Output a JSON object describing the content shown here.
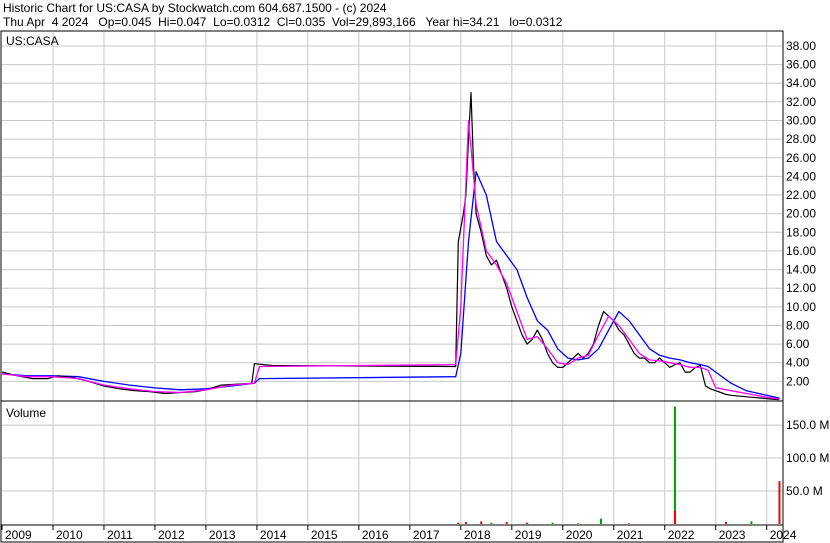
{
  "header": {
    "line1": "Historic Chart for US:CASA by Stockwatch.com 604.687.1500 - (c) 2024",
    "line2": "Thu Apr  4 2024   Op=0.045  Hi=0.047  Lo=0.0312  Cl=0.035  Vol=29,893,166   Year hi=34.21   lo=0.0312"
  },
  "price_panel_label": "US:CASA",
  "volume_panel_label": "Volume",
  "colors": {
    "grid": "#c8c8c8",
    "price_bars": "#000000",
    "ma_short": "#ff00ff",
    "ma_long": "#0000ff",
    "volume_up": "#00a000",
    "volume_down": "#ff0000",
    "frame": "#000000"
  },
  "chart_data": [
    {
      "type": "line",
      "panel": "price",
      "x_ticks": [
        "2009",
        "2010",
        "2011",
        "2012",
        "2013",
        "2014",
        "2015",
        "2016",
        "2017",
        "2018",
        "2019",
        "2020",
        "2021",
        "2022",
        "2023",
        "2024"
      ],
      "y_ticks": [
        "2.00",
        "4.00",
        "6.00",
        "8.00",
        "10.00",
        "12.00",
        "14.00",
        "16.00",
        "18.00",
        "20.00",
        "22.00",
        "24.00",
        "26.00",
        "28.00",
        "30.00",
        "32.00",
        "34.00",
        "36.00",
        "38.00"
      ],
      "ylim": [
        0,
        39.5
      ],
      "xlim": [
        2009.0,
        2024.3
      ],
      "series": [
        {
          "role": "price",
          "x": [
            2009.0,
            2009.3,
            2009.6,
            2009.9,
            2010.1,
            2010.4,
            2010.7,
            2011.0,
            2011.3,
            2011.6,
            2011.9,
            2012.2,
            2012.5,
            2012.8,
            2013.0,
            2013.3,
            2013.6,
            2013.9,
            2013.95,
            2014.3,
            2017.9,
            2017.95,
            2018.05,
            2018.1,
            2018.15,
            2018.2,
            2018.25,
            2018.3,
            2018.4,
            2018.5,
            2018.6,
            2018.7,
            2018.8,
            2018.9,
            2019.0,
            2019.1,
            2019.2,
            2019.3,
            2019.4,
            2019.5,
            2019.6,
            2019.7,
            2019.8,
            2019.9,
            2020.0,
            2020.1,
            2020.2,
            2020.3,
            2020.4,
            2020.5,
            2020.6,
            2020.7,
            2020.8,
            2020.9,
            2021.0,
            2021.1,
            2021.2,
            2021.3,
            2021.4,
            2021.5,
            2021.6,
            2021.7,
            2021.8,
            2021.9,
            2022.0,
            2022.1,
            2022.2,
            2022.3,
            2022.4,
            2022.5,
            2022.6,
            2022.7,
            2022.8,
            2022.9,
            2023.0,
            2023.1,
            2023.2,
            2023.3,
            2023.5,
            2023.7,
            2023.9,
            2024.1,
            2024.25
          ],
          "y": [
            3.0,
            2.6,
            2.3,
            2.3,
            2.6,
            2.4,
            2.0,
            1.5,
            1.2,
            1.0,
            0.9,
            0.7,
            0.8,
            0.9,
            1.1,
            1.6,
            1.7,
            1.8,
            3.9,
            3.7,
            3.6,
            17.0,
            20.0,
            22.0,
            28.0,
            33.0,
            25.0,
            20.0,
            18.0,
            15.5,
            14.5,
            15.0,
            13.5,
            12.0,
            10.0,
            8.5,
            7.0,
            6.0,
            6.5,
            7.5,
            6.5,
            5.0,
            4.0,
            3.5,
            3.5,
            4.0,
            4.5,
            5.0,
            4.5,
            5.0,
            6.0,
            8.0,
            9.5,
            9.0,
            8.5,
            7.5,
            7.0,
            6.0,
            5.0,
            4.5,
            4.5,
            4.0,
            4.0,
            4.5,
            4.0,
            3.5,
            3.8,
            4.0,
            3.0,
            3.0,
            3.5,
            3.7,
            1.5,
            1.2,
            1.0,
            0.8,
            0.6,
            0.5,
            0.4,
            0.3,
            0.2,
            0.1,
            0.04
          ]
        },
        {
          "role": "ma_short",
          "x": [
            2009.0,
            2009.5,
            2010.0,
            2010.5,
            2011.0,
            2011.5,
            2012.0,
            2012.5,
            2013.0,
            2013.5,
            2013.95,
            2014.05,
            2017.9,
            2018.0,
            2018.15,
            2018.3,
            2018.5,
            2018.7,
            2018.9,
            2019.1,
            2019.3,
            2019.5,
            2019.7,
            2019.9,
            2020.1,
            2020.3,
            2020.5,
            2020.7,
            2020.9,
            2021.1,
            2021.3,
            2021.5,
            2021.7,
            2021.9,
            2022.1,
            2022.3,
            2022.5,
            2022.7,
            2022.85,
            2023.0,
            2023.3,
            2023.6,
            2024.0,
            2024.25
          ],
          "y": [
            2.8,
            2.5,
            2.5,
            2.3,
            1.6,
            1.2,
            0.9,
            0.8,
            1.1,
            1.6,
            1.8,
            3.6,
            3.8,
            10.0,
            30.0,
            21.0,
            16.0,
            14.5,
            12.5,
            9.5,
            6.5,
            6.8,
            5.5,
            4.0,
            3.8,
            4.5,
            4.8,
            7.0,
            9.0,
            8.0,
            6.5,
            5.0,
            4.3,
            4.2,
            4.0,
            3.8,
            3.5,
            3.5,
            3.2,
            1.3,
            1.0,
            0.7,
            0.3,
            0.1
          ]
        },
        {
          "role": "ma_long",
          "x": [
            2009.0,
            2009.5,
            2010.0,
            2010.5,
            2011.0,
            2011.5,
            2012.0,
            2012.5,
            2013.0,
            2013.5,
            2013.95,
            2014.05,
            2017.9,
            2018.0,
            2018.15,
            2018.3,
            2018.5,
            2018.7,
            2018.9,
            2019.1,
            2019.3,
            2019.5,
            2019.7,
            2019.9,
            2020.1,
            2020.3,
            2020.5,
            2020.7,
            2020.9,
            2021.1,
            2021.3,
            2021.5,
            2021.7,
            2021.9,
            2022.1,
            2022.3,
            2022.5,
            2022.7,
            2022.85,
            2023.0,
            2023.3,
            2023.6,
            2024.0,
            2024.25
          ],
          "y": [
            2.8,
            2.6,
            2.6,
            2.5,
            2.0,
            1.6,
            1.3,
            1.1,
            1.2,
            1.5,
            1.8,
            2.3,
            2.5,
            5.0,
            17.0,
            24.5,
            22.0,
            17.0,
            15.5,
            14.0,
            11.0,
            8.5,
            7.5,
            5.5,
            4.5,
            4.3,
            4.5,
            5.5,
            7.5,
            9.5,
            8.5,
            7.0,
            5.5,
            4.8,
            4.5,
            4.3,
            4.0,
            3.8,
            3.6,
            3.0,
            1.8,
            1.0,
            0.5,
            0.2
          ]
        }
      ]
    },
    {
      "type": "bar",
      "panel": "volume",
      "y_ticks": [
        "50.0 M",
        "100.0 M",
        "150.0 M"
      ],
      "ylim": [
        0,
        185
      ],
      "bars": [
        {
          "x": 2022.2,
          "value": 178,
          "color": "up"
        },
        {
          "x": 2022.2,
          "value": 20,
          "color": "down"
        },
        {
          "x": 2024.25,
          "value": 65,
          "color": "down"
        },
        {
          "x": 2020.75,
          "value": 8,
          "color": "up"
        },
        {
          "x": 2023.7,
          "value": 4,
          "color": "up"
        },
        {
          "x": 2023.2,
          "value": 3,
          "color": "down"
        },
        {
          "x": 2018.1,
          "value": 3,
          "color": "down"
        },
        {
          "x": 2018.4,
          "value": 4,
          "color": "down"
        },
        {
          "x": 2018.6,
          "value": 2,
          "color": "up"
        },
        {
          "x": 2018.9,
          "value": 3,
          "color": "down"
        },
        {
          "x": 2019.3,
          "value": 2,
          "color": "down"
        },
        {
          "x": 2019.8,
          "value": 2,
          "color": "up"
        },
        {
          "x": 2020.3,
          "value": 1,
          "color": "down"
        },
        {
          "x": 2021.3,
          "value": 1,
          "color": "down"
        },
        {
          "x": 2017.95,
          "value": 2,
          "color": "down"
        }
      ]
    }
  ]
}
